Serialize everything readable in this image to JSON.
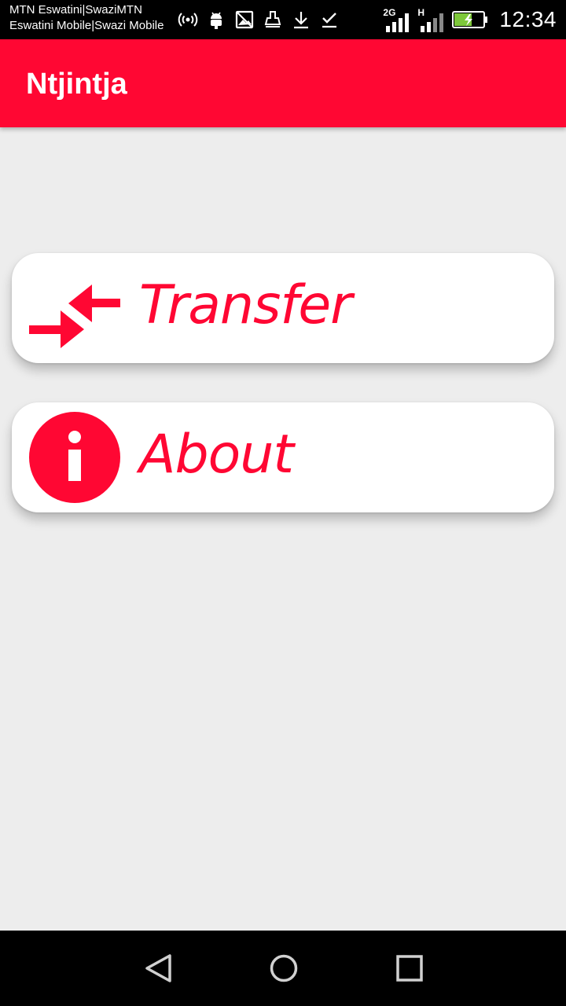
{
  "status_bar": {
    "carrier_line1": "MTN Eswatini|SwaziMTN",
    "carrier_line2": "Eswatini Mobile|Swazi Mobile",
    "network1": "2G",
    "network2": "H",
    "time": "12:34",
    "icons": [
      "hotspot-icon",
      "android-debug-icon",
      "image-icon",
      "cleaner-icon",
      "download-icon",
      "checkmark-icon",
      "signal-icon",
      "battery-charging-icon"
    ]
  },
  "app_bar": {
    "title": "Ntjintja",
    "color": "#ff0733"
  },
  "menu": {
    "items": [
      {
        "label": "Transfer",
        "icon": "transfer-arrows-icon"
      },
      {
        "label": "About",
        "icon": "info-icon"
      }
    ]
  },
  "nav_bar": {
    "buttons": [
      "back-icon",
      "home-icon",
      "recents-icon"
    ]
  }
}
